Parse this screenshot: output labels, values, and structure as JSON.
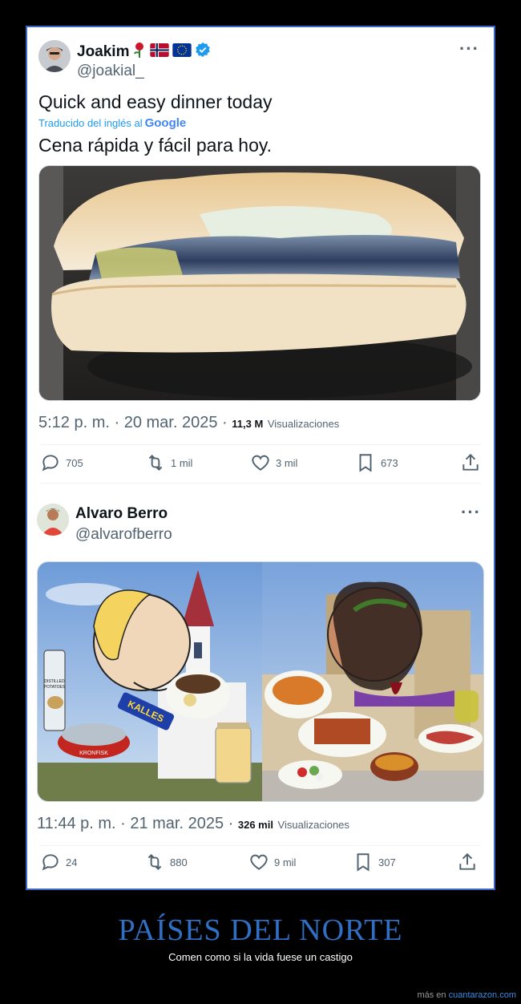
{
  "tweet1": {
    "name": "Joakim",
    "flags": [
      "rose-icon",
      "norway-flag-icon",
      "eu-flag-icon",
      "verified-badge-icon"
    ],
    "handle": "@joakial_",
    "text": "Quick and easy dinner today",
    "translated_label": "Traducido del inglés al",
    "translator": "Google",
    "translated_text": "Cena rápida y fácil para hoy.",
    "time": "5:12 p. m. · 20 mar. 2025 ·",
    "views": "11,3 M",
    "views_label": "Visualizaciones",
    "replies": "705",
    "retweets": "1 mil",
    "likes": "3 mil",
    "bookmarks": "673"
  },
  "tweet2": {
    "name": "Alvaro Berro",
    "handle": "@alvarofberro",
    "image_labels": {
      "potatoes": "DISTILLED POTATOES",
      "kalles": "KALLES",
      "can": "KRONFISK"
    },
    "time": "11:44 p. m. · 21 mar. 2025 ·",
    "views": "326 mil",
    "views_label": "Visualizaciones",
    "replies": "24",
    "retweets": "880",
    "likes": "9 mil",
    "bookmarks": "307"
  },
  "caption": {
    "title": "PAÍSES DEL NORTE",
    "subtitle": "Comen como si la vida fuese un castigo"
  },
  "footer": {
    "prefix": "más en",
    "site": "cuantarazon.com"
  },
  "colors": {
    "frame_border": "#3b66c4",
    "caption_title": "#2f6fc4",
    "link": "#1d9bf0",
    "muted": "#536471"
  }
}
